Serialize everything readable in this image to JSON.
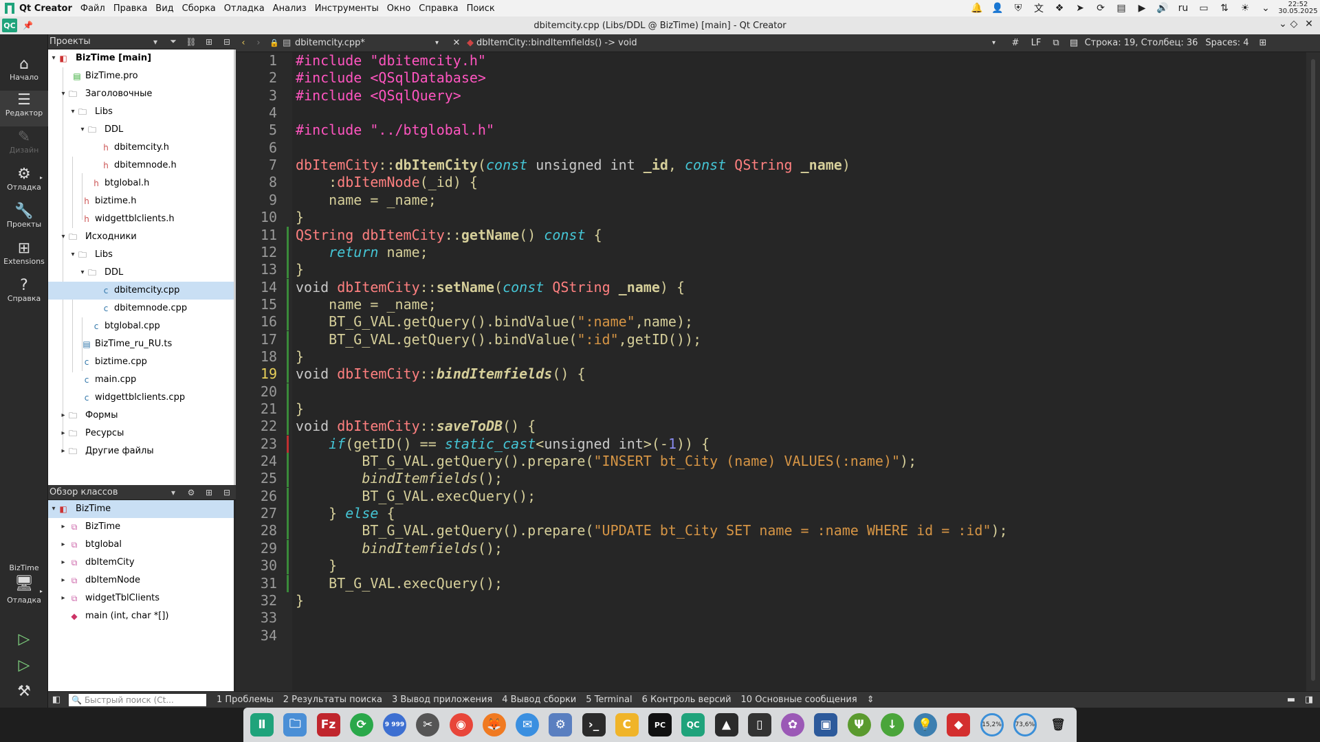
{
  "menubar": {
    "app_name": "Qt Creator",
    "items": [
      "Файл",
      "Правка",
      "Вид",
      "Сборка",
      "Отладка",
      "Анализ",
      "Инструменты",
      "Окно",
      "Справка",
      "Поиск"
    ],
    "language": "ru",
    "time": "22:52",
    "date": "30.05.2025"
  },
  "window": {
    "title": "dbitemcity.cpp (Libs/DDL @ BizTime) [main] - Qt Creator",
    "app_badge": "QC"
  },
  "modes": {
    "start": "Начало",
    "editor": "Редактор",
    "design": "Дизайн",
    "debug": "Отладка",
    "projects": "Проекты",
    "extensions": "Extensions",
    "help": "Справка",
    "target_project": "BizTime",
    "target_label": "Отладка"
  },
  "projects_panel": {
    "title": "Проекты",
    "items": [
      {
        "label": "BizTime [main]"
      },
      {
        "label": "BizTime.pro"
      },
      {
        "label": "Заголовочные"
      },
      {
        "label": "Libs"
      },
      {
        "label": "DDL"
      },
      {
        "label": "dbitemcity.h"
      },
      {
        "label": "dbitemnode.h"
      },
      {
        "label": "btglobal.h"
      },
      {
        "label": "biztime.h"
      },
      {
        "label": "widgettblclients.h"
      },
      {
        "label": "Исходники"
      },
      {
        "label": "Libs"
      },
      {
        "label": "DDL"
      },
      {
        "label": "dbitemcity.cpp"
      },
      {
        "label": "dbitemnode.cpp"
      },
      {
        "label": "btglobal.cpp"
      },
      {
        "label": "BizTime_ru_RU.ts"
      },
      {
        "label": "biztime.cpp"
      },
      {
        "label": "main.cpp"
      },
      {
        "label": "widgettblclients.cpp"
      },
      {
        "label": "Формы"
      },
      {
        "label": "Ресурсы"
      },
      {
        "label": "Другие файлы"
      }
    ]
  },
  "classes_panel": {
    "title": "Обзор классов",
    "items": [
      {
        "label": "BizTime"
      },
      {
        "label": "BizTime"
      },
      {
        "label": "btglobal"
      },
      {
        "label": "dbItemCity"
      },
      {
        "label": "dbItemNode"
      },
      {
        "label": "widgetTblClients"
      },
      {
        "label": "main (int, char *[])"
      }
    ]
  },
  "editor_toolbar": {
    "file": "dbitemcity.cpp*",
    "symbol": "dbItemCity::bindItemfields() -> void",
    "hash": "#",
    "line_ending": "LF",
    "position": "Строка: 19, Столбец: 36",
    "spaces": "Spaces: 4"
  },
  "editor": {
    "current_line": 19,
    "line_numbers": [
      "1",
      "2",
      "3",
      "4",
      "5",
      "6",
      "7",
      "8",
      "9",
      "10",
      "11",
      "12",
      "13",
      "14",
      "15",
      "16",
      "17",
      "18",
      "19",
      "20",
      "21",
      "22",
      "23",
      "24",
      "25",
      "26",
      "27",
      "28",
      "29",
      "30",
      "31",
      "32",
      "33",
      "34"
    ],
    "code_lines": [
      "#include \"dbitemcity.h\"",
      "#include <QSqlDatabase>",
      "#include <QSqlQuery>",
      "",
      "#include \"../btglobal.h\"",
      "",
      "dbItemCity::dbItemCity(const unsigned int _id, const QString _name)",
      "    :dbItemNode(_id) {",
      "    name = _name;",
      "}",
      "QString dbItemCity::getName() const {",
      "    return name;",
      "}",
      "void dbItemCity::setName(const QString _name) {",
      "    name = _name;",
      "    BT_G_VAL.getQuery().bindValue(\":name\",name);",
      "    BT_G_VAL.getQuery().bindValue(\":id\",getID());",
      "}",
      "void dbItemCity::bindItemfields() {",
      "",
      "}",
      "void dbItemCity::saveToDB() {",
      "    if(getID() == static_cast<unsigned int>(-1)) {",
      "        BT_G_VAL.getQuery().prepare(\"INSERT bt_City (name) VALUES(:name)\");",
      "        bindItemfields();",
      "        BT_G_VAL.execQuery();",
      "    } else {",
      "        BT_G_VAL.getQuery().prepare(\"UPDATE bt_City SET name = :name WHERE id = :id\");",
      "        bindItemfields();",
      "    }",
      "    BT_G_VAL.execQuery();",
      "}",
      "",
      ""
    ]
  },
  "output_tabs": {
    "search_placeholder": "Быстрый поиск (Ct...",
    "tabs": [
      "1  Проблемы",
      "2  Результаты поиска",
      "3  Вывод приложения",
      "4  Вывод сборки",
      "5  Terminal",
      "6  Контроль версий",
      "10 Основные сообщения"
    ]
  },
  "dock": {
    "badge_9999": "9 999",
    "cpu": "15,2%",
    "mem": "73,6%",
    "qc": "QC",
    "pc": "PC"
  },
  "colors": {
    "accent_green": "#1fa37b",
    "editor_bg": "#262626",
    "selection": "#c9dff4"
  }
}
